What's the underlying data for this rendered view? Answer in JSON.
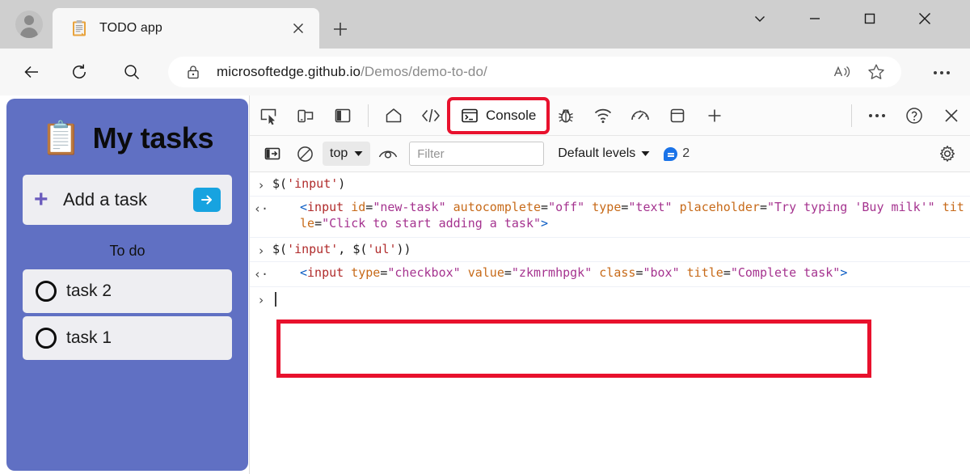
{
  "browser": {
    "tab": {
      "title": "TODO app",
      "favicon_icon": "clipboard-icon",
      "close_icon": "close-icon"
    },
    "new_tab_icon": "plus-icon",
    "window_controls": {
      "chevron_icon": "chevron-down-icon",
      "minimize_icon": "minimize-icon",
      "maximize_icon": "maximize-icon",
      "close_icon": "close-icon"
    },
    "nav": {
      "back_icon": "back-arrow-icon",
      "reload_icon": "reload-icon",
      "search_icon": "search-icon"
    },
    "address": {
      "lock_icon": "lock-icon",
      "domain": "microsoftedge.github.io",
      "path": "/Demos/demo-to-do/",
      "read_aloud_icon": "read-aloud-icon",
      "favorite_icon": "star-icon"
    },
    "settings_icon": "ellipsis-icon"
  },
  "todo_app": {
    "emoji": "📋",
    "title": "My tasks",
    "add_task": {
      "plus_icon": "plus-icon",
      "label": "Add a task",
      "submit_icon": "arrow-right-icon"
    },
    "section_label": "To do",
    "tasks": [
      {
        "label": "task 2",
        "checkbox_icon": "circle-checkbox-icon"
      },
      {
        "label": "task 1",
        "checkbox_icon": "circle-checkbox-icon"
      }
    ]
  },
  "devtools": {
    "toolbar": {
      "inspect_icon": "inspect-element-icon",
      "device_icon": "device-emulation-icon",
      "dock_icon": "dock-side-icon",
      "welcome_icon": "home-icon",
      "elements_icon": "elements-code-icon",
      "console_label": "Console",
      "console_icon": "console-terminal-icon",
      "debugger_icon": "bug-icon",
      "network_icon": "network-wifi-icon",
      "performance_icon": "performance-gauge-icon",
      "application_icon": "application-storage-icon",
      "more_tabs_icon": "plus-icon",
      "more_tools_icon": "ellipsis-icon",
      "help_icon": "help-circle-icon",
      "close_icon": "close-icon"
    },
    "filterbar": {
      "sidebar_icon": "console-sidebar-icon",
      "clear_icon": "clear-console-icon",
      "context": "top",
      "context_caret_icon": "chevron-down-icon",
      "live_expression_icon": "eye-icon",
      "filter_placeholder": "Filter",
      "levels_label": "Default levels",
      "levels_caret_icon": "chevron-down-icon",
      "message_badge_icon": "info-bubble-icon",
      "message_count": "2",
      "settings_icon": "gear-icon"
    },
    "console": {
      "entries": [
        {
          "gutter_icon": "prompt-chevron-icon",
          "type": "input",
          "code": "$('input')"
        },
        {
          "gutter_icon": "return-chevron-icon",
          "type": "output",
          "tag": "input",
          "attrs": [
            {
              "name": "id",
              "value": "new-task"
            },
            {
              "name": "autocomplete",
              "value": "off"
            },
            {
              "name": "type",
              "value": "text"
            },
            {
              "name": "placeholder",
              "value": "Try typing 'Buy milk'"
            },
            {
              "name": "title",
              "value": "Click to start adding a task"
            }
          ]
        },
        {
          "gutter_icon": "prompt-chevron-icon",
          "type": "input",
          "code": "$('input', $('ul'))",
          "highlighted": true
        },
        {
          "gutter_icon": "return-chevron-icon",
          "type": "output",
          "tag": "input",
          "attrs": [
            {
              "name": "type",
              "value": "checkbox"
            },
            {
              "name": "value",
              "value": "zkmrmhpgk"
            },
            {
              "name": "class",
              "value": "box"
            },
            {
              "name": "title",
              "value": "Complete task"
            }
          ]
        }
      ],
      "prompt_gutter_icon": "prompt-chevron-icon",
      "prompt_value": ""
    }
  },
  "annotations": {
    "highlight_color": "#e8112d",
    "boxes": [
      {
        "target": "console-tab"
      },
      {
        "target": "console-command-group"
      }
    ]
  }
}
